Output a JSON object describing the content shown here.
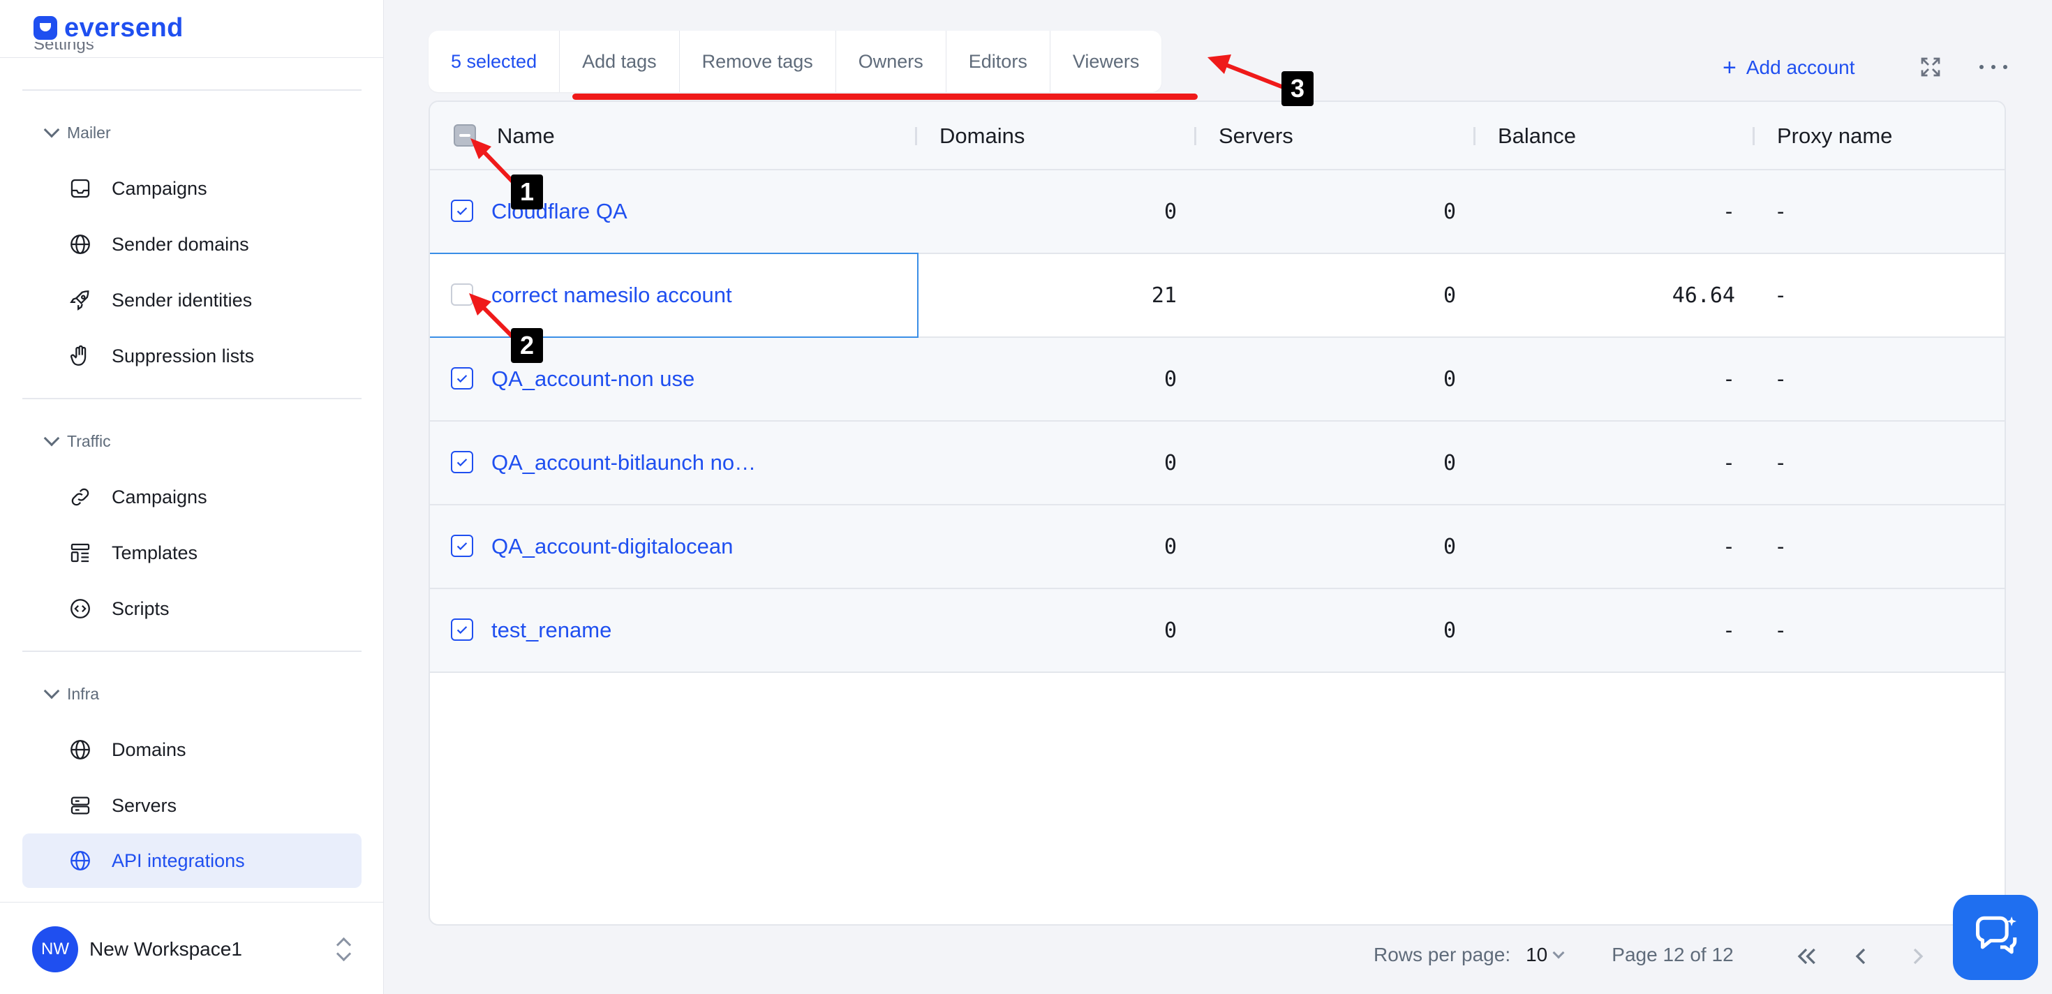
{
  "brand": {
    "name": "eversend"
  },
  "sidebar": {
    "scroll_ghost": "Settings",
    "groups": [
      {
        "title": "Mailer",
        "items": [
          {
            "label": "Campaigns",
            "icon": "inbox-icon"
          },
          {
            "label": "Sender domains",
            "icon": "globe-icon"
          },
          {
            "label": "Sender identities",
            "icon": "rocket-icon"
          },
          {
            "label": "Suppression lists",
            "icon": "hand-icon"
          }
        ]
      },
      {
        "title": "Traffic",
        "items": [
          {
            "label": "Campaigns",
            "icon": "link-icon"
          },
          {
            "label": "Templates",
            "icon": "template-icon"
          },
          {
            "label": "Scripts",
            "icon": "code-icon"
          }
        ]
      },
      {
        "title": "Infra",
        "items": [
          {
            "label": "Domains",
            "icon": "globe-icon"
          },
          {
            "label": "Servers",
            "icon": "server-icon"
          },
          {
            "label": "API integrations",
            "icon": "globe-icon",
            "active": true
          }
        ]
      }
    ],
    "workspace": {
      "initials": "NW",
      "name": "New Workspace1"
    }
  },
  "toolbar": {
    "selected": "5 selected",
    "add_tags": "Add tags",
    "remove_tags": "Remove tags",
    "owners": "Owners",
    "editors": "Editors",
    "viewers": "Viewers"
  },
  "actions": {
    "add_account": "Add account"
  },
  "table": {
    "columns": {
      "name": "Name",
      "domains": "Domains",
      "servers": "Servers",
      "balance": "Balance",
      "proxy": "Proxy name"
    },
    "rows": [
      {
        "name": "Cloudflare QA",
        "domains": "0",
        "servers": "0",
        "balance": "-",
        "proxy": "-",
        "checked": true
      },
      {
        "name": "correct namesilo account",
        "domains": "21",
        "servers": "0",
        "balance": "46.64",
        "proxy": "-",
        "checked": false
      },
      {
        "name": "QA_account-non use",
        "domains": "0",
        "servers": "0",
        "balance": "-",
        "proxy": "-",
        "checked": true
      },
      {
        "name": "QA_account-bitlaunch no…",
        "domains": "0",
        "servers": "0",
        "balance": "-",
        "proxy": "-",
        "checked": true
      },
      {
        "name": "QA_account-digitalocean",
        "domains": "0",
        "servers": "0",
        "balance": "-",
        "proxy": "-",
        "checked": true
      },
      {
        "name": "test_rename",
        "domains": "0",
        "servers": "0",
        "balance": "-",
        "proxy": "-",
        "checked": true
      }
    ]
  },
  "pagination": {
    "rows_label": "Rows per page:",
    "rows_value": "10",
    "page_label": "Page 12 of 12"
  },
  "annotations": {
    "one": "1",
    "two": "2",
    "three": "3"
  },
  "colors": {
    "accent": "#1f4ff0",
    "annotation": "#ef1a1a",
    "chat": "#1f6ff0"
  }
}
